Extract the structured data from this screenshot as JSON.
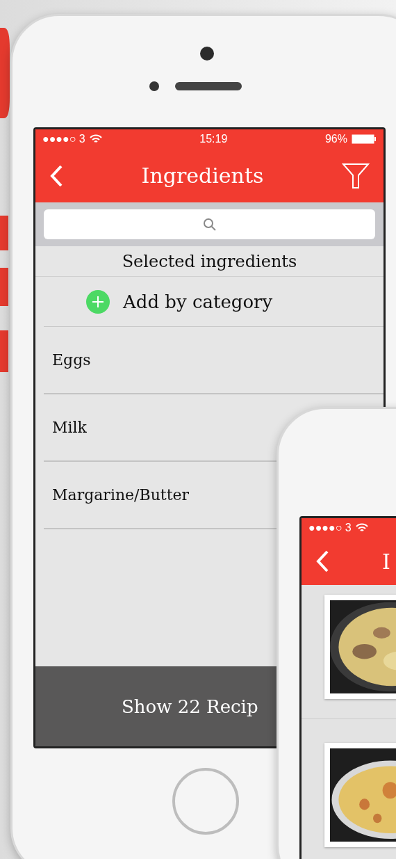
{
  "main_phone": {
    "status_bar": {
      "carrier": "●●●●○ 3",
      "time": "15:19",
      "battery": "96%"
    },
    "nav_bar": {
      "title": "Ingredients"
    },
    "section_title": "Selected ingredients",
    "add_row": {
      "label": "Add by category"
    },
    "ingredients": [
      {
        "name": "Eggs"
      },
      {
        "name": "Milk"
      },
      {
        "name": "Margarine/Butter"
      }
    ],
    "footer_button": "Show 22 Recip"
  },
  "second_phone": {
    "status_bar": {
      "carrier": "●●●●○ 3"
    },
    "nav_bar": {
      "title": "I"
    }
  }
}
